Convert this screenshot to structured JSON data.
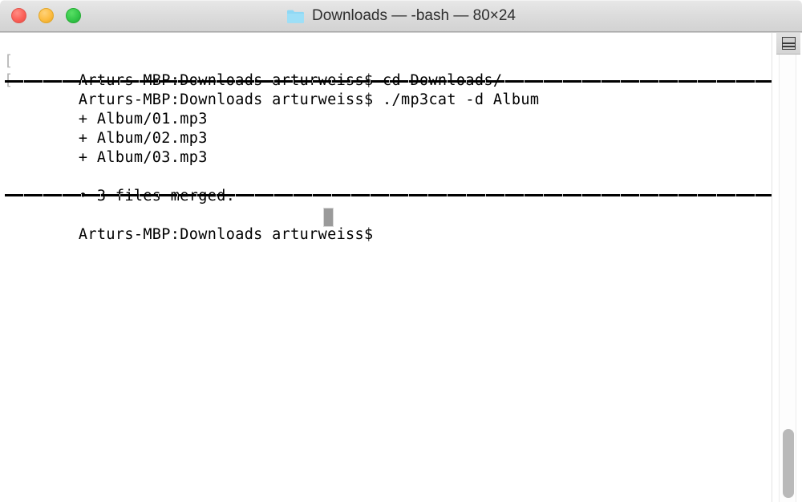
{
  "window": {
    "title": "Downloads — -bash — 80×24",
    "folder_icon": "folder-icon",
    "controls": {
      "close_label": "close",
      "minimize_label": "minimize",
      "zoom_label": "zoom"
    },
    "colors": {
      "close": "#fc6058",
      "minimize": "#fdbc40",
      "zoom": "#34c749",
      "titlebar": "#dcdcdc",
      "background": "#ffffff",
      "text": "#000000",
      "cursor": "#9a9a9a",
      "scroll_thumb": "#b9b9b9",
      "folder": "#8fd8f4"
    }
  },
  "terminal": {
    "prompt": "Arturs-MBP:Downloads arturweiss$",
    "lines": [
      {
        "id": "line-cmd-cd",
        "kind": "command",
        "marker_left": "[",
        "marker_right": "]",
        "text": "Arturs-MBP:Downloads arturweiss$ cd Downloads/"
      },
      {
        "id": "line-cmd-mp3cat",
        "kind": "command",
        "marker_left": "[",
        "marker_right": "]",
        "text": "Arturs-MBP:Downloads arturweiss$ ./mp3cat -d Album"
      },
      {
        "id": "line-rule-top",
        "kind": "rule",
        "text": ""
      },
      {
        "id": "line-file-01",
        "kind": "output",
        "text": "+ Album/01.mp3"
      },
      {
        "id": "line-file-02",
        "kind": "output",
        "text": "+ Album/02.mp3"
      },
      {
        "id": "line-file-03",
        "kind": "output",
        "text": "+ Album/03.mp3"
      },
      {
        "id": "line-summary",
        "kind": "output",
        "text": "• 3 files merged."
      },
      {
        "id": "line-rule-bottom",
        "kind": "rule",
        "text": ""
      },
      {
        "id": "line-prompt-active",
        "kind": "prompt",
        "text": "Arturs-MBP:Downloads arturweiss$"
      }
    ]
  },
  "scrollbar": {
    "split_button_label": "split-pane",
    "thumb_label": "scroll-thumb"
  }
}
